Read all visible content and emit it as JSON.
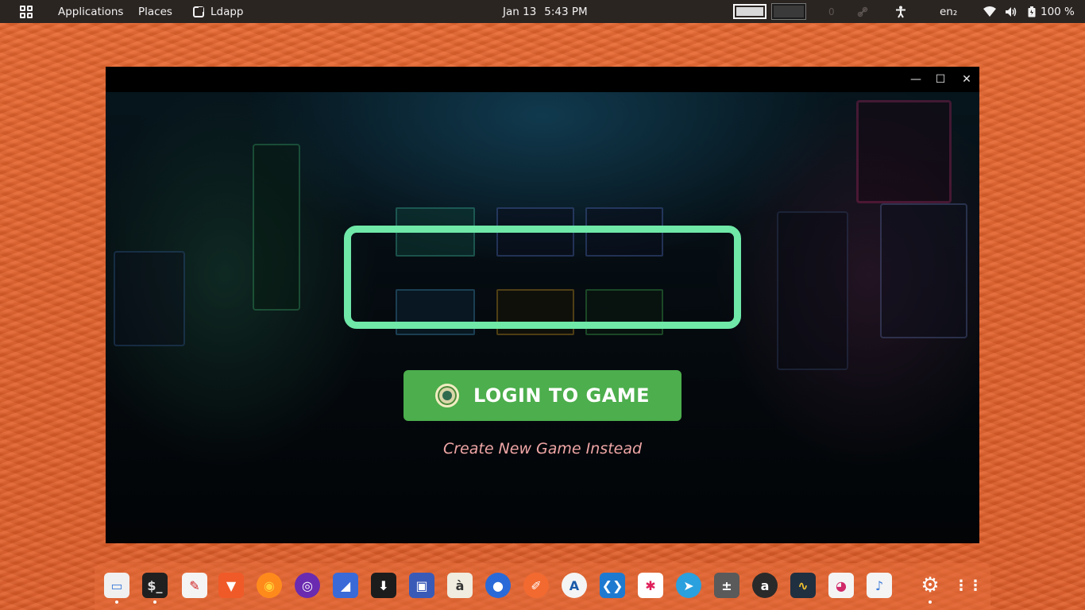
{
  "topbar": {
    "applications": "Applications",
    "places": "Places",
    "active_app": "Ldapp",
    "date": "Jan 13",
    "time": "5:43 PM",
    "indicator_zero": "0",
    "keyboard_layout": "en₂",
    "battery": "100 %"
  },
  "window": {
    "minimize_glyph": "—",
    "maximize_glyph": "☐",
    "close_glyph": "✕"
  },
  "app": {
    "login_button_label": "LOGIN TO GAME",
    "create_link": "Create New Game Instead",
    "accent_color": "#6fe8a8",
    "button_color": "#4cae4c",
    "link_color": "#f0a6a6"
  },
  "dock": {
    "items": [
      {
        "name": "files",
        "glyph": "▭"
      },
      {
        "name": "terminal",
        "glyph": "$_"
      },
      {
        "name": "text-editor",
        "glyph": "✎"
      },
      {
        "name": "brave",
        "glyph": "▼"
      },
      {
        "name": "firefox",
        "glyph": "◉"
      },
      {
        "name": "tor-browser",
        "glyph": "◎"
      },
      {
        "name": "dolphin",
        "glyph": "◢"
      },
      {
        "name": "downloader",
        "glyph": "⬇"
      },
      {
        "name": "screen-recorder",
        "glyph": "▣"
      },
      {
        "name": "character-map",
        "glyph": "à"
      },
      {
        "name": "globe",
        "glyph": "●"
      },
      {
        "name": "pen",
        "glyph": "✐"
      },
      {
        "name": "android-studio",
        "glyph": "A"
      },
      {
        "name": "vscode",
        "glyph": "❮❯"
      },
      {
        "name": "slack",
        "glyph": "✱"
      },
      {
        "name": "telegram",
        "glyph": "➤"
      },
      {
        "name": "calculator",
        "glyph": "±"
      },
      {
        "name": "amazon",
        "glyph": "a"
      },
      {
        "name": "system-monitor",
        "glyph": "∿"
      },
      {
        "name": "image-viewer",
        "glyph": "◕"
      },
      {
        "name": "games",
        "glyph": "♪"
      },
      {
        "name": "settings",
        "glyph": "⚙"
      },
      {
        "name": "app-grid",
        "glyph": "⋮⋮"
      }
    ]
  }
}
